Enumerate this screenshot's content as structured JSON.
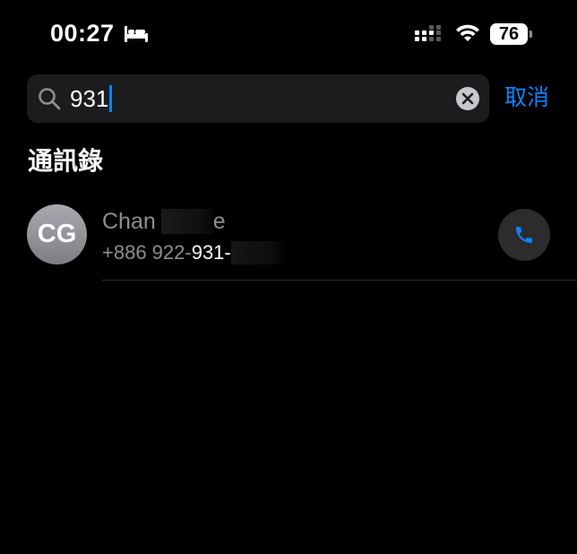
{
  "status_bar": {
    "time": "00:27",
    "battery_level": "76",
    "icons": [
      "bed-icon",
      "signal-icon",
      "wifi-icon",
      "battery-icon"
    ]
  },
  "search": {
    "query": "931",
    "cancel_label": "取消",
    "icons": [
      "search-icon",
      "clear-icon"
    ]
  },
  "section": {
    "title": "通訊錄"
  },
  "results": [
    {
      "initials": "CG",
      "name_prefix": "Chan",
      "name_suffix": "e",
      "phone_prefix": "+886 922-",
      "phone_match": "931-",
      "action_icon": "phone-icon"
    }
  ],
  "colors": {
    "background": "#000000",
    "accent": "#0a84ff",
    "search_field": "#1c1c1e",
    "secondary_text": "#8e8e93",
    "call_button": "#2c2c2e",
    "avatar": "#8e8f95"
  }
}
